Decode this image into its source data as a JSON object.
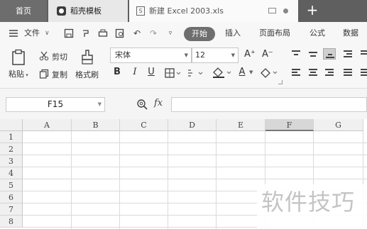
{
  "tabs": {
    "home": "首页",
    "template": "稻壳模板",
    "doc": "新建 Excel 2003.xls",
    "add": "+",
    "doc_icon": "S"
  },
  "menu": {
    "file": "文件",
    "start": "开始",
    "insert": "插入",
    "page_layout": "页面布局",
    "formula": "公式",
    "data": "数据"
  },
  "ribbon": {
    "paste": "粘贴",
    "cut": "剪切",
    "copy": "复制",
    "format_painter": "格式刷",
    "font_name": "宋体",
    "font_size": "12",
    "bold": "B",
    "italic": "I",
    "underline": "U",
    "font_color": "A",
    "grow": "A⁺",
    "shrink": "A⁻"
  },
  "formula_bar": {
    "cell_ref": "F15",
    "fx": "fx",
    "value": ""
  },
  "sheet": {
    "columns": [
      "A",
      "B",
      "C",
      "D",
      "E",
      "F",
      "G"
    ],
    "selected_column": "F",
    "rows": [
      "1",
      "2",
      "3",
      "4",
      "5",
      "6",
      "7",
      "8"
    ]
  },
  "watermark": "软件技巧",
  "icons": [
    "hamburger-icon",
    "save-icon",
    "undo-icon",
    "redo-icon",
    "print-icon",
    "preview-icon",
    "zoom-icon",
    "scissors-icon",
    "copy-icon",
    "brush-icon",
    "border-icon",
    "fill-icon",
    "eraser-icon",
    "monitor-icon"
  ]
}
